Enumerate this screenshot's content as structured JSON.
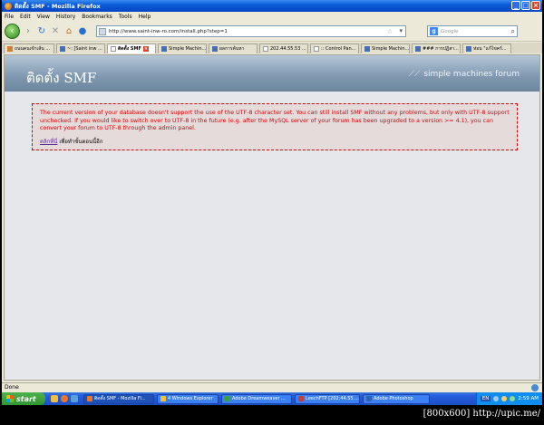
{
  "window": {
    "title": "ติดตั้ง SMF - Mozilla Firefox"
  },
  "menu": [
    "File",
    "Edit",
    "View",
    "History",
    "Bookmarks",
    "Tools",
    "Help"
  ],
  "nav": {
    "url": "http://www.saint-inw-ro.com/install.php?step=1",
    "search_placeholder": "Google"
  },
  "tabs": [
    {
      "label": "ถนนคนเข้าเส้น ..."
    },
    {
      "label": "~: [Saint inw ..."
    },
    {
      "label": "ติดตั้ง SMF",
      "active": true
    },
    {
      "label": "Simple Machin..."
    },
    {
      "label": "ผลการค้นหา"
    },
    {
      "label": "202.44.55.53 ..."
    },
    {
      "label": ":: Control Pan..."
    },
    {
      "label": "Simple Machin..."
    },
    {
      "label": "### การปฏิสา..."
    },
    {
      "label": "ห่อน \"แก้ไขคร์..."
    }
  ],
  "page": {
    "header_title": "ติดตั้ง SMF",
    "logo_text": "simple machines forum",
    "error_message": "The current version of your database doesn't support the use of the UTF-8 character set. You can still install SMF without any problems, but only with UTF-8 support unchecked. If you would like to switch over to UTF-8 in the future (e.g. after the MySQL server of your forum has been upgraded to a version >= 4.1), you can convert your forum to UTF-8 through the admin panel.",
    "retry_link": "คลิกที่นี่",
    "retry_text": "เพื่อทำขั้นตอนนี้อีก"
  },
  "status": {
    "text": "Done"
  },
  "taskbar": {
    "start_label": "start",
    "buttons": [
      {
        "label": "ติดตั้ง SMF - Mozilla Fi...",
        "active": true,
        "color": "#e8762c"
      },
      {
        "label": "4 Windows Explorer",
        "color": "#f0c040"
      },
      {
        "label": "Adobe Dreamweaver ...",
        "color": "#3aa040"
      },
      {
        "label": "LeechFTP [202.44.55....",
        "color": "#c04040"
      },
      {
        "label": "Adobe Photoshop",
        "color": "#3060b0"
      }
    ],
    "lang": "EN",
    "clock": "2:59 AM"
  },
  "watermark": "[800x600] http://upic.me/"
}
